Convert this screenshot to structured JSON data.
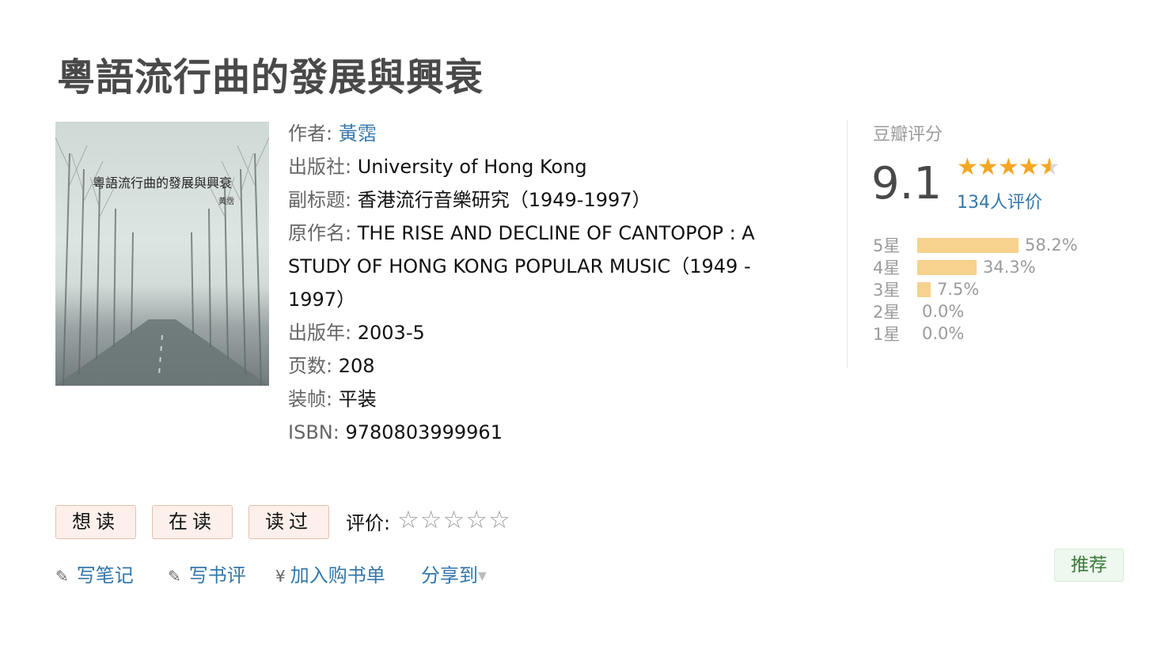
{
  "page": {
    "title": "粵語流行曲的發展與興衰"
  },
  "cover": {
    "title": "粵語流行曲的發展與興衰",
    "author": "黃霑"
  },
  "info": {
    "author_label": "作者:",
    "author": "黃霑",
    "publisher_label": "出版社:",
    "publisher": "University of Hong Kong",
    "subtitle_label": "副标题:",
    "subtitle": "香港流行音樂研究（1949-1997）",
    "original_label": "原作名:",
    "original": "THE RISE AND DECLINE OF CANTOPOP : A STUDY OF HONG KONG POPULAR MUSIC（1949 - 1997）",
    "year_label": "出版年:",
    "year": "2003-5",
    "pages_label": "页数:",
    "pages": "208",
    "binding_label": "装帧:",
    "binding": "平装",
    "isbn_label": "ISBN:",
    "isbn": "9780803999961"
  },
  "rating": {
    "title": "豆瓣评分",
    "score": "9.1",
    "stars": 4.5,
    "count": "134人评价",
    "distribution": [
      {
        "label": "5星",
        "percent": 58.2,
        "text": "58.2%"
      },
      {
        "label": "4星",
        "percent": 34.3,
        "text": "34.3%"
      },
      {
        "label": "3星",
        "percent": 7.5,
        "text": "7.5%"
      },
      {
        "label": "2星",
        "percent": 0.0,
        "text": "0.0%"
      },
      {
        "label": "1星",
        "percent": 0.0,
        "text": "0.0%"
      }
    ]
  },
  "actions": {
    "want": "想读",
    "reading": "在读",
    "read": "读过",
    "rate_label": "评价:",
    "rate_stars": "☆☆☆☆☆"
  },
  "links": {
    "note": "写笔记",
    "review": "写书评",
    "booklist": "加入购书单",
    "share": "分享到",
    "recommend": "推荐"
  },
  "icons": {
    "pencil": "pencil-icon",
    "yen": "yen-icon",
    "caret": "caret-down-icon"
  },
  "colors": {
    "link": "#3377aa",
    "bar": "#f7d18e",
    "star": "#f5a623",
    "button_bg": "#fdf0ea"
  }
}
